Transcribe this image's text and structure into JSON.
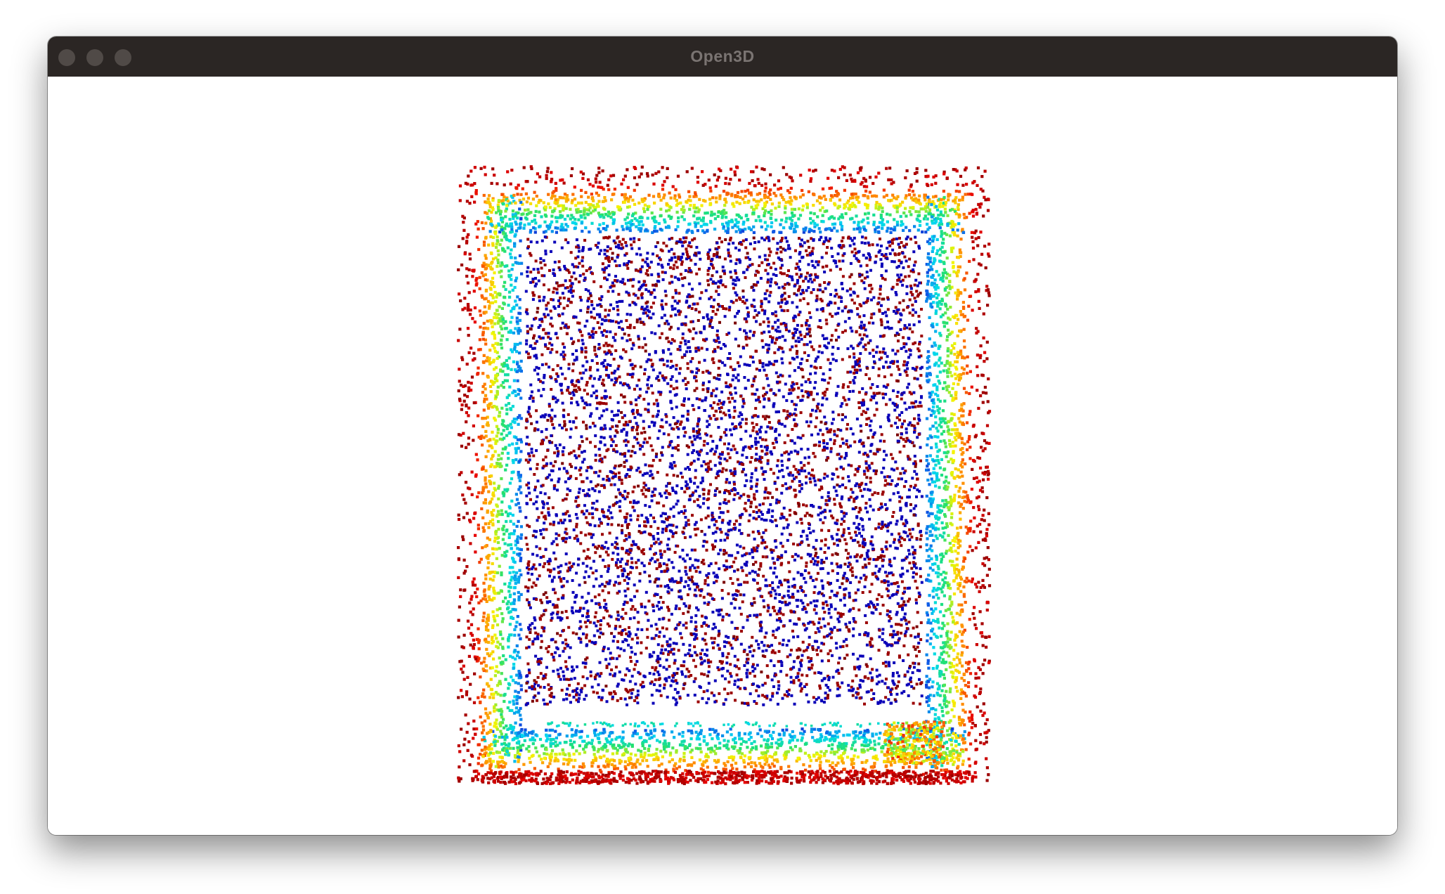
{
  "window": {
    "title": "Open3D",
    "buttons": {
      "close": "close-button",
      "minimize": "minimize-button",
      "zoom": "zoom-button"
    }
  },
  "viewport": {
    "background": "#ffffff",
    "content": "point-cloud",
    "colormap": "jet",
    "colors": {
      "outer": "#9b0000",
      "red": "#e80000",
      "orange": "#ff8800",
      "yellow": "#f5f500",
      "green": "#22e070",
      "cyan": "#00d8f0",
      "blue": "#1060e8",
      "inner": "#0a00b8"
    }
  }
}
